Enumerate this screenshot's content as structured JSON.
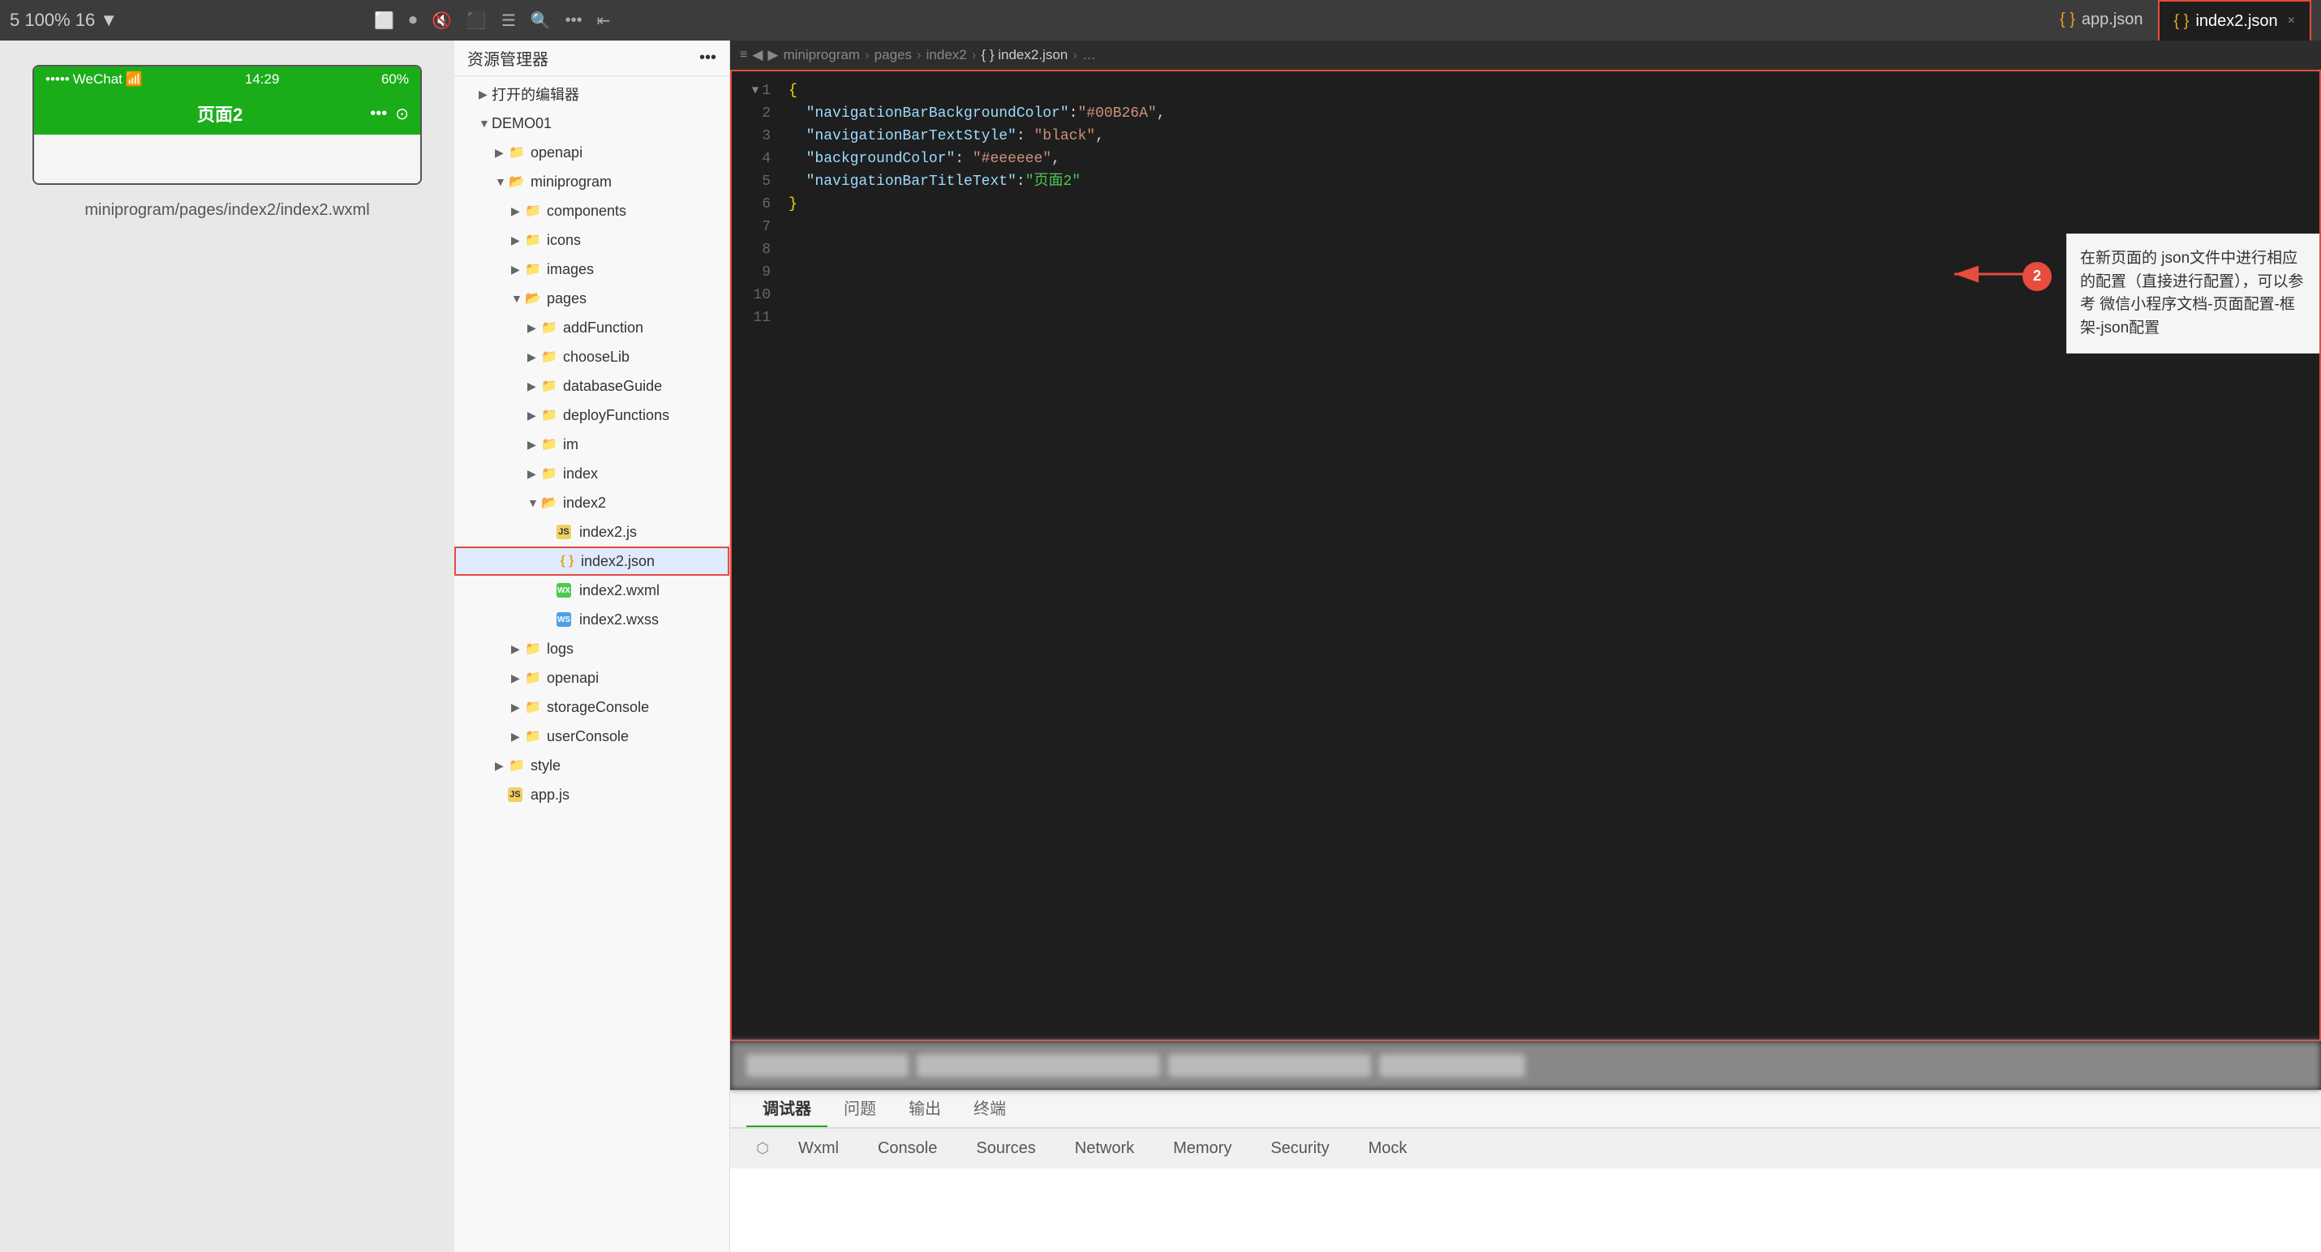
{
  "toolbar": {
    "zoom_label": "5 100% 16 ▼",
    "app_json_tab": "app.json",
    "index2_json_tab": "index2.json",
    "close_icon": "×",
    "icons": [
      "☰",
      "⊞",
      "◯",
      "⊡",
      "≡",
      "🔍",
      "•••",
      "⇤"
    ]
  },
  "sidebar": {
    "title": "资源管理器",
    "more_icon": "•••",
    "opened_editors_label": "打开的编辑器",
    "demo_label": "DEMO01",
    "tree": [
      {
        "id": "openapi",
        "label": "openapi",
        "type": "folder",
        "depth": 2
      },
      {
        "id": "miniprogram",
        "label": "miniprogram",
        "type": "folder-open",
        "depth": 2
      },
      {
        "id": "components",
        "label": "components",
        "type": "folder",
        "depth": 3
      },
      {
        "id": "icons",
        "label": "icons",
        "type": "folder",
        "depth": 3
      },
      {
        "id": "images",
        "label": "images",
        "type": "folder",
        "depth": 3
      },
      {
        "id": "pages",
        "label": "pages",
        "type": "folder-open",
        "depth": 3
      },
      {
        "id": "addFunction",
        "label": "addFunction",
        "type": "folder",
        "depth": 4
      },
      {
        "id": "chooseLib",
        "label": "chooseLib",
        "type": "folder",
        "depth": 4
      },
      {
        "id": "databaseGuide",
        "label": "databaseGuide",
        "type": "folder",
        "depth": 4
      },
      {
        "id": "deployFunctions",
        "label": "deployFunctions",
        "type": "folder",
        "depth": 4
      },
      {
        "id": "im",
        "label": "im",
        "type": "folder",
        "depth": 4
      },
      {
        "id": "index",
        "label": "index",
        "type": "folder",
        "depth": 4
      },
      {
        "id": "index2",
        "label": "index2",
        "type": "folder-open",
        "depth": 4
      },
      {
        "id": "index2.js",
        "label": "index2.js",
        "type": "js",
        "depth": 5
      },
      {
        "id": "index2.json",
        "label": "index2.json",
        "type": "json",
        "depth": 5,
        "highlighted": true
      },
      {
        "id": "index2.wxml",
        "label": "index2.wxml",
        "type": "wxml",
        "depth": 5
      },
      {
        "id": "index2.wxss",
        "label": "index2.wxss",
        "type": "wxss",
        "depth": 5
      },
      {
        "id": "logs",
        "label": "logs",
        "type": "folder",
        "depth": 3
      },
      {
        "id": "openapi2",
        "label": "openapi",
        "type": "folder",
        "depth": 3
      },
      {
        "id": "storageConsole",
        "label": "storageConsole",
        "type": "folder",
        "depth": 3
      },
      {
        "id": "userConsole",
        "label": "userConsole",
        "type": "folder",
        "depth": 3
      },
      {
        "id": "style",
        "label": "style",
        "type": "folder",
        "depth": 2
      },
      {
        "id": "app.js",
        "label": "app.js",
        "type": "js",
        "depth": 2
      }
    ]
  },
  "breadcrumb": {
    "items": [
      "miniprogram",
      "pages",
      "index2",
      "{ } index2.json",
      ">…"
    ]
  },
  "editor": {
    "filename": "index2.json",
    "lines": [
      {
        "num": 1,
        "content": "{",
        "has_fold": true
      },
      {
        "num": 2,
        "content": "  \"navigationBarBackgroundColor\":\"#00B26A\","
      },
      {
        "num": 3,
        "content": "  \"navigationBarTextStyle\": \"black\","
      },
      {
        "num": 4,
        "content": "  \"backgroundColor\": \"#eeeeee\","
      },
      {
        "num": 5,
        "content": "  \"navigationBarTitleText\":\"页面2\""
      },
      {
        "num": 6,
        "content": ""
      },
      {
        "num": 7,
        "content": ""
      },
      {
        "num": 8,
        "content": ""
      },
      {
        "num": 9,
        "content": ""
      },
      {
        "num": 10,
        "content": "}"
      },
      {
        "num": 11,
        "content": ""
      }
    ]
  },
  "annotation": {
    "step": "2",
    "text": "在新页面的 json文件中进行相应的配置（直接进行配置），可以参考 微信小程序文档-页面配置-框架-json配置"
  },
  "preview": {
    "wechat_label": "••••• WeChat",
    "wifi_icon": "📶",
    "time": "14:29",
    "battery": "60%",
    "page_title": "页面2",
    "path_label": "miniprogram/pages/index2/index2.wxml"
  },
  "bottom": {
    "tabs": [
      {
        "id": "debugger",
        "label": "调试器",
        "active": true
      },
      {
        "id": "problems",
        "label": "问题"
      },
      {
        "id": "output",
        "label": "输出"
      },
      {
        "id": "terminal",
        "label": "终端"
      }
    ],
    "devtools_tabs": [
      {
        "id": "wxml",
        "label": "Wxml"
      },
      {
        "id": "console",
        "label": "Console"
      },
      {
        "id": "sources",
        "label": "Sources"
      },
      {
        "id": "network",
        "label": "Network"
      },
      {
        "id": "memory",
        "label": "Memory"
      },
      {
        "id": "security",
        "label": "Security"
      },
      {
        "id": "mock",
        "label": "Mock"
      }
    ]
  },
  "colors": {
    "wechat_green": "#1aad19",
    "active_tab_border": "#e74c3c",
    "annotation_red": "#e74c3c"
  }
}
